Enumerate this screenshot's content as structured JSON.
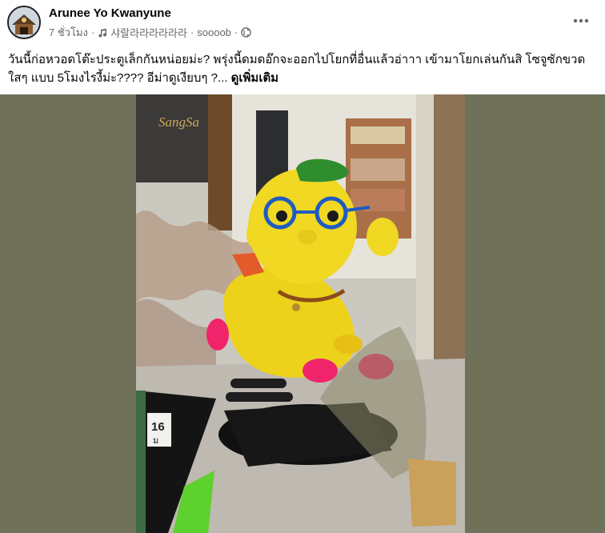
{
  "post": {
    "author": "Arunee Yo Kwanyune",
    "time": "7 ชั่วโมง",
    "music": "샤랄라라라라라라",
    "song_artist": "soooob",
    "caption_text": "วันนี้ก่อหวอดโต๊ะประตูเล็กกันหน่อยม่ะ? พรุ่งนี้ดมดอ๊กจะออกไปโยกที่อื่นแล้วอ่าาา   เข้ามาโยกเล่นกันสิ โซจูซักขวดใสๆ  แบบ 5โมงไรงี้ม่ะ????  อีม่าดูเงียบๆ ?...",
    "see_more": "ดูเพิ่มเติม"
  },
  "photo": {
    "sign_text": "SangSa",
    "price_number": "16",
    "price_sub": "ม"
  },
  "colors": {
    "text_primary": "#050505",
    "text_secondary": "#65676b",
    "media_letterbox": "#6f7159",
    "toy_yellow": "#ecd21a",
    "toy_pink": "#f0246a"
  },
  "icons": [
    "music-note-icon",
    "globe-icon",
    "more-options-icon"
  ]
}
